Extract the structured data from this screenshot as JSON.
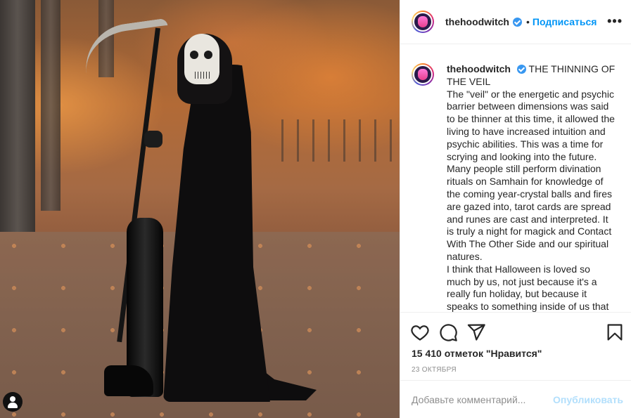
{
  "post": {
    "image_alt": "photo",
    "owner_avatar_icon": "user-icon"
  },
  "header": {
    "username": "thehoodwitch",
    "separator": "•",
    "follow_label": "Подписаться",
    "more_icon": "more-horizontal-icon",
    "more_label": "•••"
  },
  "caption": {
    "username": "thehoodwitch",
    "lines": [
      "THE THINNING OF THE VEIL",
      "The \"veil\" or the energetic and psychic barrier between dimensions was said to be thinner at this time, it allowed the living to have increased intuition and psychic abilities. This was a time for scrying and looking into the future. Many people still perform divination rituals on Samhain for knowledge of the coming year-crystal balls and fires are gazed into, tarot cards are spread and runes are cast and interpreted. It is truly a night for magick and Contact With The Other Side and our spiritual natures.",
      "I think that Halloween is loved so much by us, not just because it's a really fun holiday, but because it speaks to something inside of us that"
    ]
  },
  "actions": {
    "like_icon": "heart-icon",
    "comment_icon": "comment-icon",
    "share_icon": "send-icon",
    "save_icon": "bookmark-icon"
  },
  "likes": "15 410 отметок \"Нравится\"",
  "date": "23 октября",
  "comment": {
    "placeholder": "Добавьте комментарий...",
    "publish_label": "Опубликовать"
  },
  "colors": {
    "accent": "#0095f6",
    "publish_disabled": "#b2dffc",
    "verified": "#3897f0",
    "muted": "#8e8e8e",
    "border": "#efefef"
  }
}
